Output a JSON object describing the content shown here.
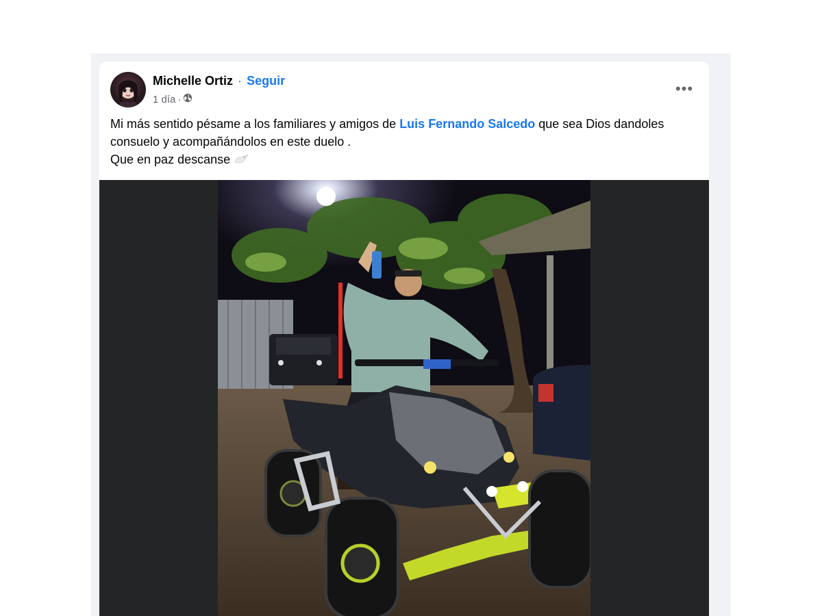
{
  "post": {
    "author": "Michelle Ortiz",
    "separator": "·",
    "follow_label": "Seguir",
    "time": "1 día",
    "time_separator": "·",
    "audience_icon": "globe-icon",
    "more_icon": "more-options-icon",
    "more_label": "•••",
    "text": {
      "line1_before": "Mi más sentido pésame a los familiares y amigos de ",
      "mention": "Luis Fernando Salcedo",
      "line1_after": " que sea Dios dandoles consuelo y acompañándolos en este duelo .",
      "line2": "Que en paz descanse",
      "emoji_icon": "white-dove-icon"
    }
  },
  "colors": {
    "link": "#1877f2",
    "secondary_text": "#65676b",
    "media_background": "#242526"
  }
}
